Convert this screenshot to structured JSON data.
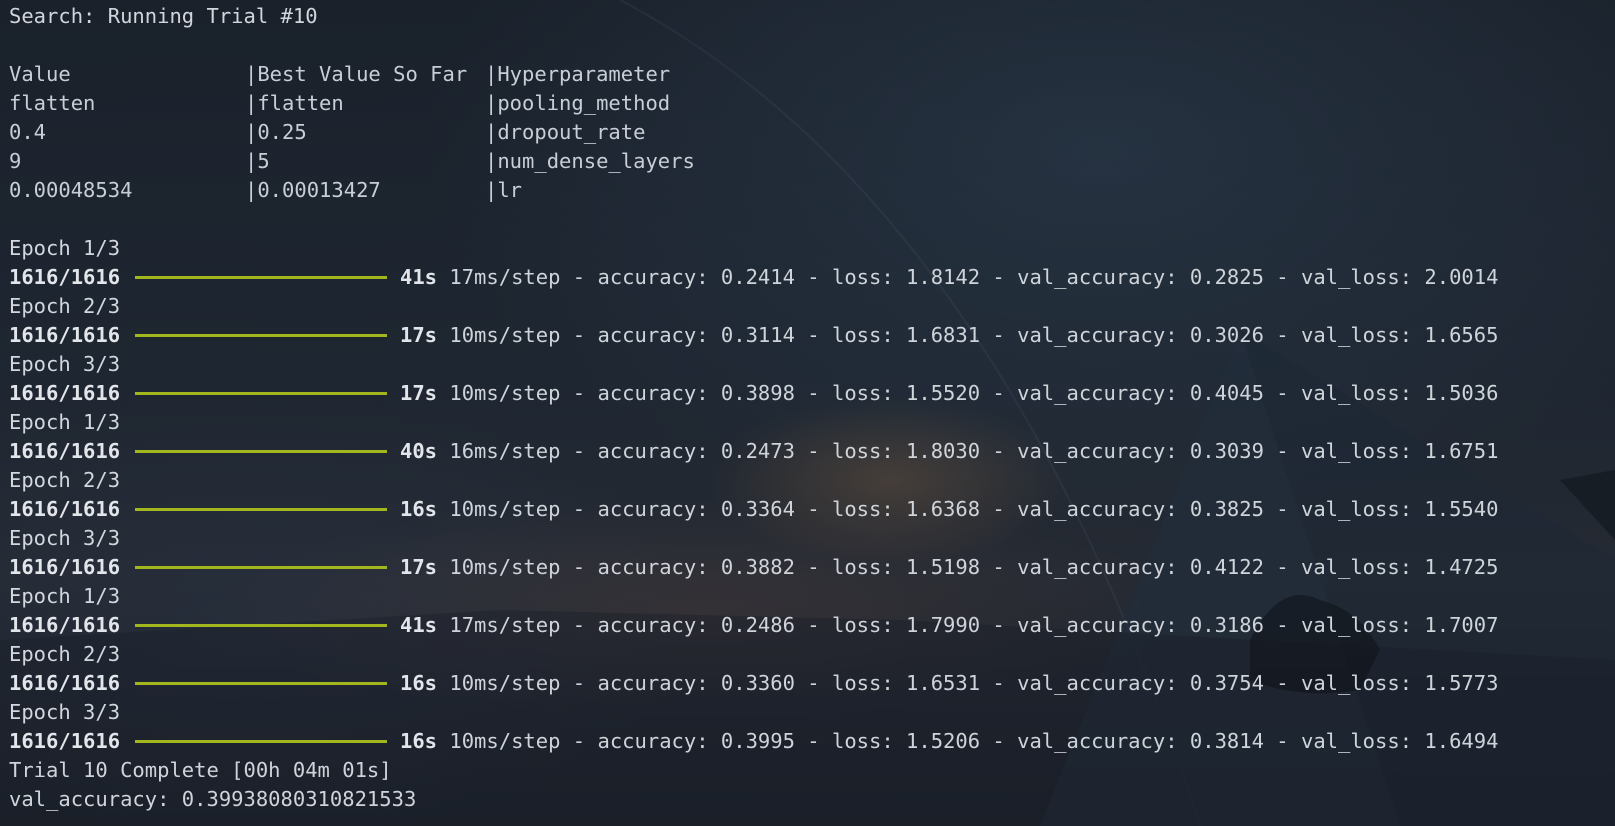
{
  "terminal": {
    "title": "Search: Running Trial #10",
    "hp_table": {
      "headers": [
        "Value",
        "Best Value So Far",
        "Hyperparameter"
      ],
      "rows": [
        [
          "flatten",
          "flatten",
          "pooling_method"
        ],
        [
          "0.4",
          "0.25",
          "dropout_rate"
        ],
        [
          "9",
          "5",
          "num_dense_layers"
        ],
        [
          "0.00048534",
          "0.00013427",
          "lr"
        ]
      ]
    },
    "epochs": [
      {
        "epoch": "Epoch 1/3",
        "steps": "1616/1616",
        "time": "41s",
        "rest": " 17ms/step - accuracy: 0.2414 - loss: 1.8142 - val_accuracy: 0.2825 - val_loss: 2.0014",
        "progress": 1.0
      },
      {
        "epoch": "Epoch 2/3",
        "steps": "1616/1616",
        "time": "17s",
        "rest": " 10ms/step - accuracy: 0.3114 - loss: 1.6831 - val_accuracy: 0.3026 - val_loss: 1.6565",
        "progress": 1.0
      },
      {
        "epoch": "Epoch 3/3",
        "steps": "1616/1616",
        "time": "17s",
        "rest": " 10ms/step - accuracy: 0.3898 - loss: 1.5520 - val_accuracy: 0.4045 - val_loss: 1.5036",
        "progress": 1.0
      },
      {
        "epoch": "Epoch 1/3",
        "steps": "1616/1616",
        "time": "40s",
        "rest": " 16ms/step - accuracy: 0.2473 - loss: 1.8030 - val_accuracy: 0.3039 - val_loss: 1.6751",
        "progress": 1.0
      },
      {
        "epoch": "Epoch 2/3",
        "steps": "1616/1616",
        "time": "16s",
        "rest": " 10ms/step - accuracy: 0.3364 - loss: 1.6368 - val_accuracy: 0.3825 - val_loss: 1.5540",
        "progress": 1.0
      },
      {
        "epoch": "Epoch 3/3",
        "steps": "1616/1616",
        "time": "17s",
        "rest": " 10ms/step - accuracy: 0.3882 - loss: 1.5198 - val_accuracy: 0.4122 - val_loss: 1.4725",
        "progress": 1.0
      },
      {
        "epoch": "Epoch 1/3",
        "steps": "1616/1616",
        "time": "41s",
        "rest": " 17ms/step - accuracy: 0.2486 - loss: 1.7990 - val_accuracy: 0.3186 - val_loss: 1.7007",
        "progress": 1.0
      },
      {
        "epoch": "Epoch 2/3",
        "steps": "1616/1616",
        "time": "16s",
        "rest": " 10ms/step - accuracy: 0.3360 - loss: 1.6531 - val_accuracy: 0.3754 - val_loss: 1.5773",
        "progress": 1.0
      },
      {
        "epoch": "Epoch 3/3",
        "steps": "1616/1616",
        "time": "16s",
        "rest": " 10ms/step - accuracy: 0.3995 - loss: 1.5206 - val_accuracy: 0.3814 - val_loss: 1.6494",
        "progress": 1.0
      }
    ],
    "trial_complete": "Trial 10 Complete [00h 04m 01s]",
    "val_accuracy_line": "val_accuracy: 0.39938080310821533"
  },
  "colors": {
    "background": "#161c25",
    "text": "#c9ced6",
    "progress_bar": "#a2b61e"
  }
}
